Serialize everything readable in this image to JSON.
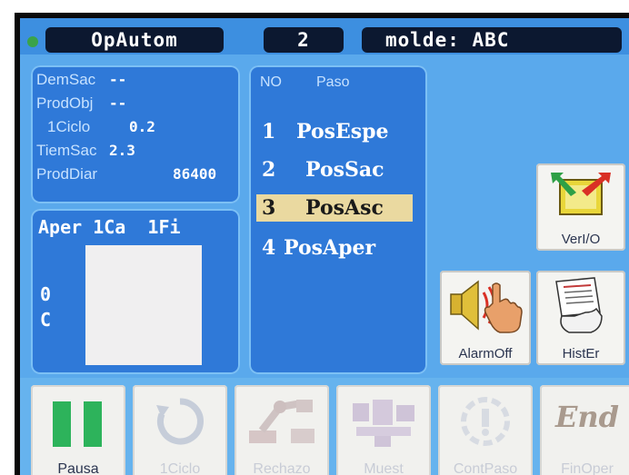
{
  "header": {
    "mode": "OpAutom",
    "number": "2",
    "mold": "molde: ABC"
  },
  "stats": {
    "rows": [
      {
        "label": "DemSac",
        "value": "--"
      },
      {
        "label": "ProdObj",
        "value": "--"
      },
      {
        "label": "1Ciclo",
        "value": "0.2"
      },
      {
        "label": "TiemSac",
        "value": "2.3"
      },
      {
        "label": "ProdDiar",
        "value": "86400"
      }
    ]
  },
  "gauge": {
    "title": "Aper 1Ca  1Fi",
    "value": "0",
    "unit": "C"
  },
  "steps": {
    "col_no": "NO",
    "col_step": "Paso",
    "items": [
      {
        "no": "1",
        "name": "PosEspe"
      },
      {
        "no": "2",
        "name": "PosSac"
      },
      {
        "no": "3",
        "name": "PosAsc"
      },
      {
        "no": "4",
        "name": "PosAper"
      }
    ],
    "selected_index": 2
  },
  "side_buttons": {
    "verio": "VerI/O",
    "alarmoff": "AlarmOff",
    "hister": "HistEr"
  },
  "bottom_buttons": {
    "pausa": "Pausa",
    "ciclo": "1Ciclo",
    "rechazo": "Rechazo",
    "muest": "Muest",
    "contpaso": "ContPaso",
    "finoper": "FinOper",
    "end_text": "End"
  },
  "colors": {
    "screen_bg": "#5aa9ec",
    "panel": "#2f79d8",
    "selected_row": "#ead9a0",
    "pause_green": "#2db35b"
  }
}
